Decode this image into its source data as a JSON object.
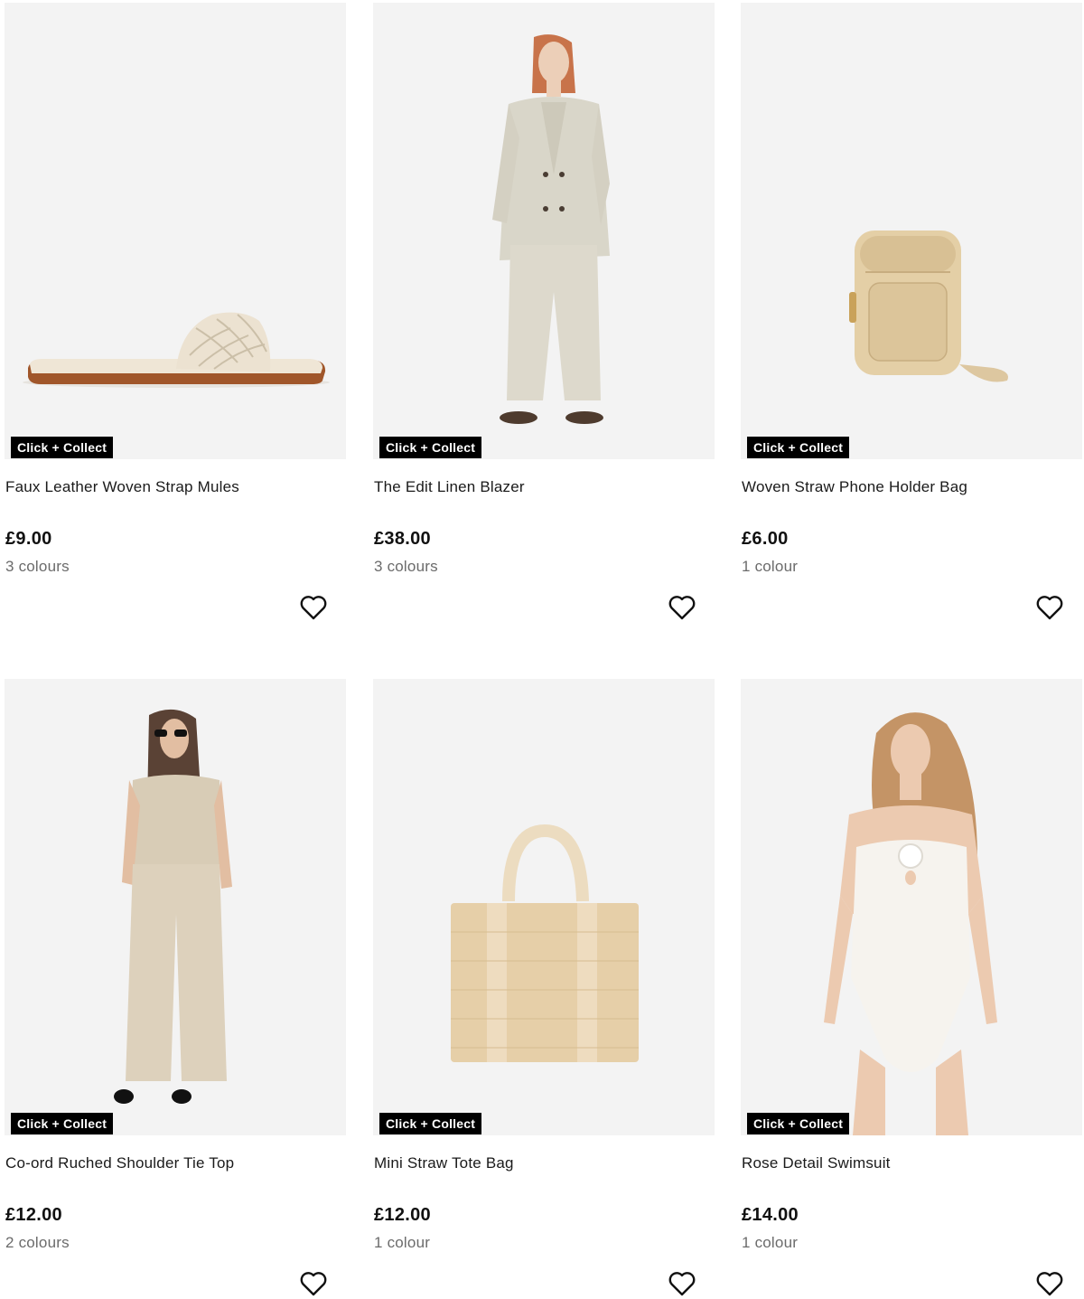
{
  "badge_label": "Click + Collect",
  "products": [
    {
      "name": "Faux Leather Woven Strap Mules",
      "price": "£9.00",
      "colours": "3 colours",
      "image": "woven-mule-sandal"
    },
    {
      "name": "The Edit Linen Blazer",
      "price": "£38.00",
      "colours": "3 colours",
      "image": "model-linen-suit"
    },
    {
      "name": "Woven Straw Phone Holder Bag",
      "price": "£6.00",
      "colours": "1 colour",
      "image": "straw-phone-bag"
    },
    {
      "name": "Co-ord Ruched Shoulder Tie Top",
      "price": "£12.00",
      "colours": "2 colours",
      "image": "model-linen-coord"
    },
    {
      "name": "Mini Straw Tote Bag",
      "price": "£12.00",
      "colours": "1 colour",
      "image": "straw-tote-bag"
    },
    {
      "name": "Rose Detail Swimsuit",
      "price": "£14.00",
      "colours": "1 colour",
      "image": "model-white-swimsuit"
    }
  ],
  "colors": {
    "badge_bg": "#000000",
    "badge_text": "#ffffff",
    "image_bg": "#f3f3f3",
    "muted_text": "#6b6b6b"
  }
}
